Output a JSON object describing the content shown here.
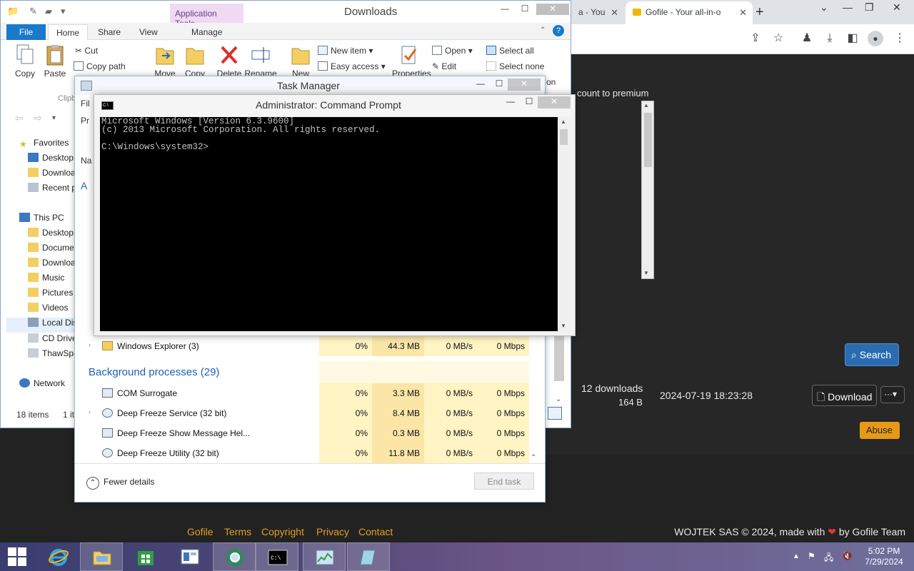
{
  "browser": {
    "tabs": [
      {
        "title": "a - You",
        "active": false
      },
      {
        "title": "Gofile - Your all-in-o",
        "active": true
      }
    ],
    "new_tab": "+",
    "page": {
      "premium_text": "count to premium",
      "search_label": "Search",
      "file_row": {
        "downloads": "12 downloads",
        "size": "164 B",
        "date": "2024-07-19 18:23:28",
        "download_label": "Download",
        "more_label": "···▾"
      },
      "abuse_label": "Abuse",
      "footer": {
        "links": [
          "Gofile",
          "Terms",
          "Copyright",
          "Privacy",
          "Contact"
        ],
        "copyright_pre": "WOJTEK SAS © 2024, made with",
        "heart": "❤",
        "copyright_post": "by Gofile Team"
      },
      "accent_color": "#e0a020"
    }
  },
  "explorer": {
    "title": "Downloads",
    "context_tab": "Application Tools",
    "tabs": {
      "file": "File",
      "home": "Home",
      "share": "Share",
      "view": "View",
      "manage": "Manage"
    },
    "ribbon": {
      "copy": "Copy",
      "paste": "Paste",
      "cut": "Cut",
      "copy_path": "Copy path",
      "clipboard_group": "Clipb",
      "move": "Move",
      "copy_to": "Copy",
      "delete": "Delete",
      "rename": "Rename",
      "new": "New",
      "new_item": "New item ▾",
      "easy_access": "Easy access ▾",
      "properties": "Properties",
      "open": "Open ▾",
      "edit": "Edit",
      "select_all": "Select all",
      "select_none": "Select none",
      "invert_fragment": "on"
    },
    "nav": {
      "favorites": "Favorites",
      "fav_items": [
        "Desktop",
        "Downloa",
        "Recent p"
      ],
      "this_pc": "This PC",
      "pc_items": [
        "Desktop",
        "Docume",
        "Downloa",
        "Music",
        "Pictures",
        "Videos",
        "Local Dis",
        "CD Drive",
        "ThawSpa"
      ],
      "network": "Network"
    },
    "status": {
      "items": "18 items",
      "selected": "1 it"
    }
  },
  "task_manager": {
    "title": "Task Manager",
    "edge_labels": {
      "file": "Fil",
      "processes": "Pr",
      "name": "Na",
      "apps": "A"
    },
    "app_row": {
      "name": "Windows Explorer (3)",
      "cpu": "0%",
      "memory": "44.3 MB",
      "disk": "0 MB/s",
      "network": "0 Mbps"
    },
    "section": "Background processes (29)",
    "rows": [
      {
        "name": "COM Surrogate",
        "cpu": "0%",
        "memory": "3.3 MB",
        "disk": "0 MB/s",
        "network": "0 Mbps",
        "expandable": false,
        "icon": "window-icon"
      },
      {
        "name": "Deep Freeze Service (32 bit)",
        "cpu": "0%",
        "memory": "8.4 MB",
        "disk": "0 MB/s",
        "network": "0 Mbps",
        "expandable": true,
        "icon": "bear-icon"
      },
      {
        "name": "Deep Freeze Show Message Hel...",
        "cpu": "0%",
        "memory": "0.3 MB",
        "disk": "0 MB/s",
        "network": "0 Mbps",
        "expandable": false,
        "icon": "window-icon"
      },
      {
        "name": "Deep Freeze Utility (32 bit)",
        "cpu": "0%",
        "memory": "11.8 MB",
        "disk": "0 MB/s",
        "network": "0 Mbps",
        "expandable": false,
        "icon": "bear-icon"
      }
    ],
    "fewer_details": "Fewer details",
    "end_task": "End task"
  },
  "cmd": {
    "title": "Administrator: Command Prompt",
    "lines": [
      "Microsoft Windows [Version 6.3.9600]",
      "(c) 2013 Microsoft Corporation. All rights reserved.",
      "",
      "C:\\Windows\\system32>"
    ]
  },
  "taskbar": {
    "buttons": [
      "start",
      "internet-explorer",
      "file-explorer",
      "store",
      "control-panel",
      "browser",
      "command-prompt",
      "task-manager",
      "app"
    ],
    "clock_time": "5:02 PM",
    "clock_date": "7/29/2024"
  }
}
